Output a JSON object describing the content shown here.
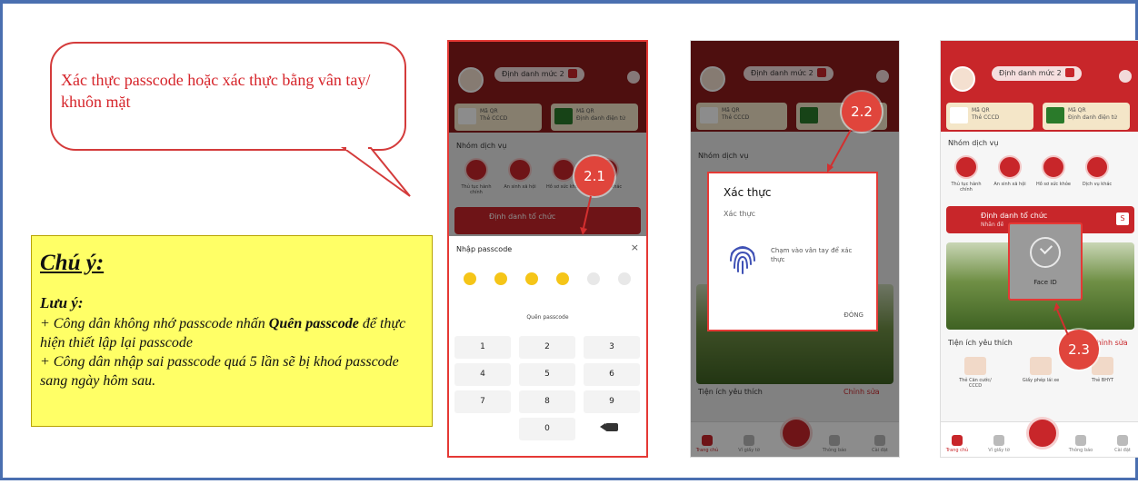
{
  "callout": {
    "text": "Xác thực passcode hoặc xác thực bằng vân tay/ khuôn mặt"
  },
  "note": {
    "title": "Chú ý:",
    "subtitle": "Lưu ý:",
    "line1_before": "+ Công dân không nhớ passcode nhấn ",
    "line1_bold": "Quên passcode",
    "line1_after": " để thực hiện thiết lập lại passcode",
    "line2": "+ Công dân nhập sai passcode quá 5 lần sẽ bị khoá passcode sang ngày hôm sau."
  },
  "steps": {
    "s1": "2.1",
    "s2": "2.2",
    "s3": "2.3"
  },
  "app": {
    "level_label": "Định danh mức 2",
    "card_qr_title": "Mã QR",
    "card_qr_sub": "Thẻ CCCD",
    "card_id_title": "Mã QR",
    "card_id_sub": "Định danh điện tử",
    "services_title": "Nhóm dịch vụ",
    "services": [
      {
        "label": "Thủ tục hành chính"
      },
      {
        "label": "An sinh xã hội"
      },
      {
        "label": "Hồ sơ sức khỏe"
      },
      {
        "label": "Dịch vụ khác"
      }
    ],
    "org_banner": "Định danh tổ chức",
    "org_banner_sub": "Nhấn để",
    "org_badge": "S",
    "fav_title": "Tiện ích yêu thích",
    "fav_edit": "Chỉnh sửa",
    "favs": [
      {
        "label": "Thẻ Căn cước/ CCCD"
      },
      {
        "label": "Giấy phép lái xe"
      },
      {
        "label": "Thẻ BHYT"
      }
    ],
    "nav": [
      {
        "label": "Trang chủ"
      },
      {
        "label": "Ví giấy tờ"
      },
      {
        "label": "Thông báo"
      },
      {
        "label": "Cài đặt"
      }
    ]
  },
  "passcode": {
    "title": "Nhập passcode",
    "close": "×",
    "filled": 4,
    "total": 6,
    "forgot": "Quên passcode",
    "keys": [
      "1",
      "2",
      "3",
      "4",
      "5",
      "6",
      "7",
      "8",
      "9",
      "",
      "0",
      "del"
    ]
  },
  "auth_dialog": {
    "title": "Xác thực",
    "subtitle": "Xác thực",
    "hint": "Chạm vào vân tay để xác thực",
    "close": "ĐÓNG"
  },
  "faceid": {
    "label": "Face ID"
  }
}
